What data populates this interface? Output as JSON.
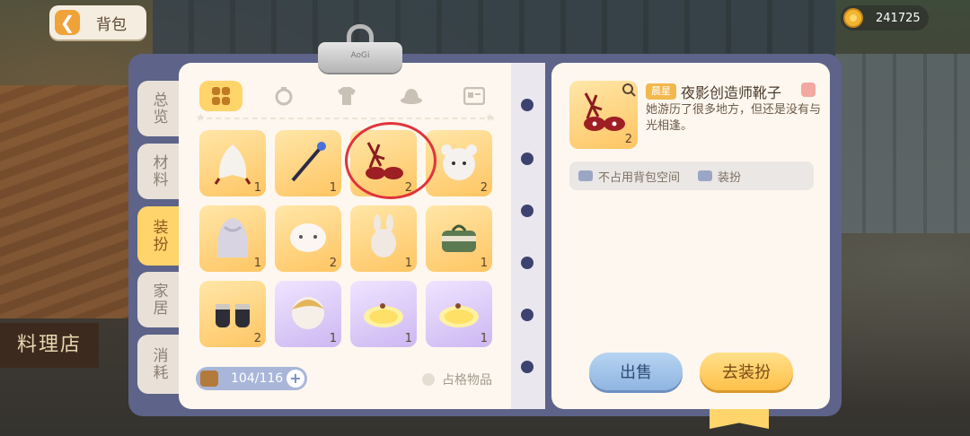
{
  "header": {
    "back_label": "背包",
    "coins": "241725"
  },
  "clip_label": "AoGi",
  "side_tabs": [
    {
      "label": "总览",
      "active": false
    },
    {
      "label": "材料",
      "active": false
    },
    {
      "label": "装扮",
      "active": true
    },
    {
      "label": "家居",
      "active": false
    },
    {
      "label": "消耗",
      "active": false
    }
  ],
  "category_icons": [
    "grid-icon",
    "accessory-icon",
    "shirt-icon",
    "hat-icon",
    "card-icon"
  ],
  "items": [
    {
      "name": "white-wing-cape",
      "count": "1",
      "rarity": "gold"
    },
    {
      "name": "dark-scepter",
      "count": "1",
      "rarity": "gold"
    },
    {
      "name": "night-shadow-boots",
      "count": "2",
      "rarity": "gold",
      "selected": true
    },
    {
      "name": "bear-head-hat",
      "count": "2",
      "rarity": "gold"
    },
    {
      "name": "silver-long-wig",
      "count": "1",
      "rarity": "gold"
    },
    {
      "name": "cute-face-mask",
      "count": "2",
      "rarity": "gold"
    },
    {
      "name": "bunny-backpack",
      "count": "1",
      "rarity": "gold"
    },
    {
      "name": "travel-bag",
      "count": "1",
      "rarity": "gold"
    },
    {
      "name": "black-boots",
      "count": "2",
      "rarity": "gold"
    },
    {
      "name": "golden-hair-wig",
      "count": "1",
      "rarity": "purple"
    },
    {
      "name": "lemon-slice-hat",
      "count": "1",
      "rarity": "purple"
    },
    {
      "name": "lemon-slice-hat-2",
      "count": "1",
      "rarity": "purple"
    }
  ],
  "capacity": "104/116",
  "occupy_label": "占格物品",
  "detail": {
    "rarity": "晨星",
    "name": "夜影创造师靴子",
    "description": "她游历了很多地方，但还是没有与光相逢。",
    "count": "2",
    "tags": [
      "不占用背包空间",
      "装扮"
    ]
  },
  "buttons": {
    "sell": "出售",
    "equip": "去装扮"
  },
  "colors": {
    "accent": "#ffd46b",
    "frame": "#5d6389",
    "highlight": "#e0343b"
  }
}
